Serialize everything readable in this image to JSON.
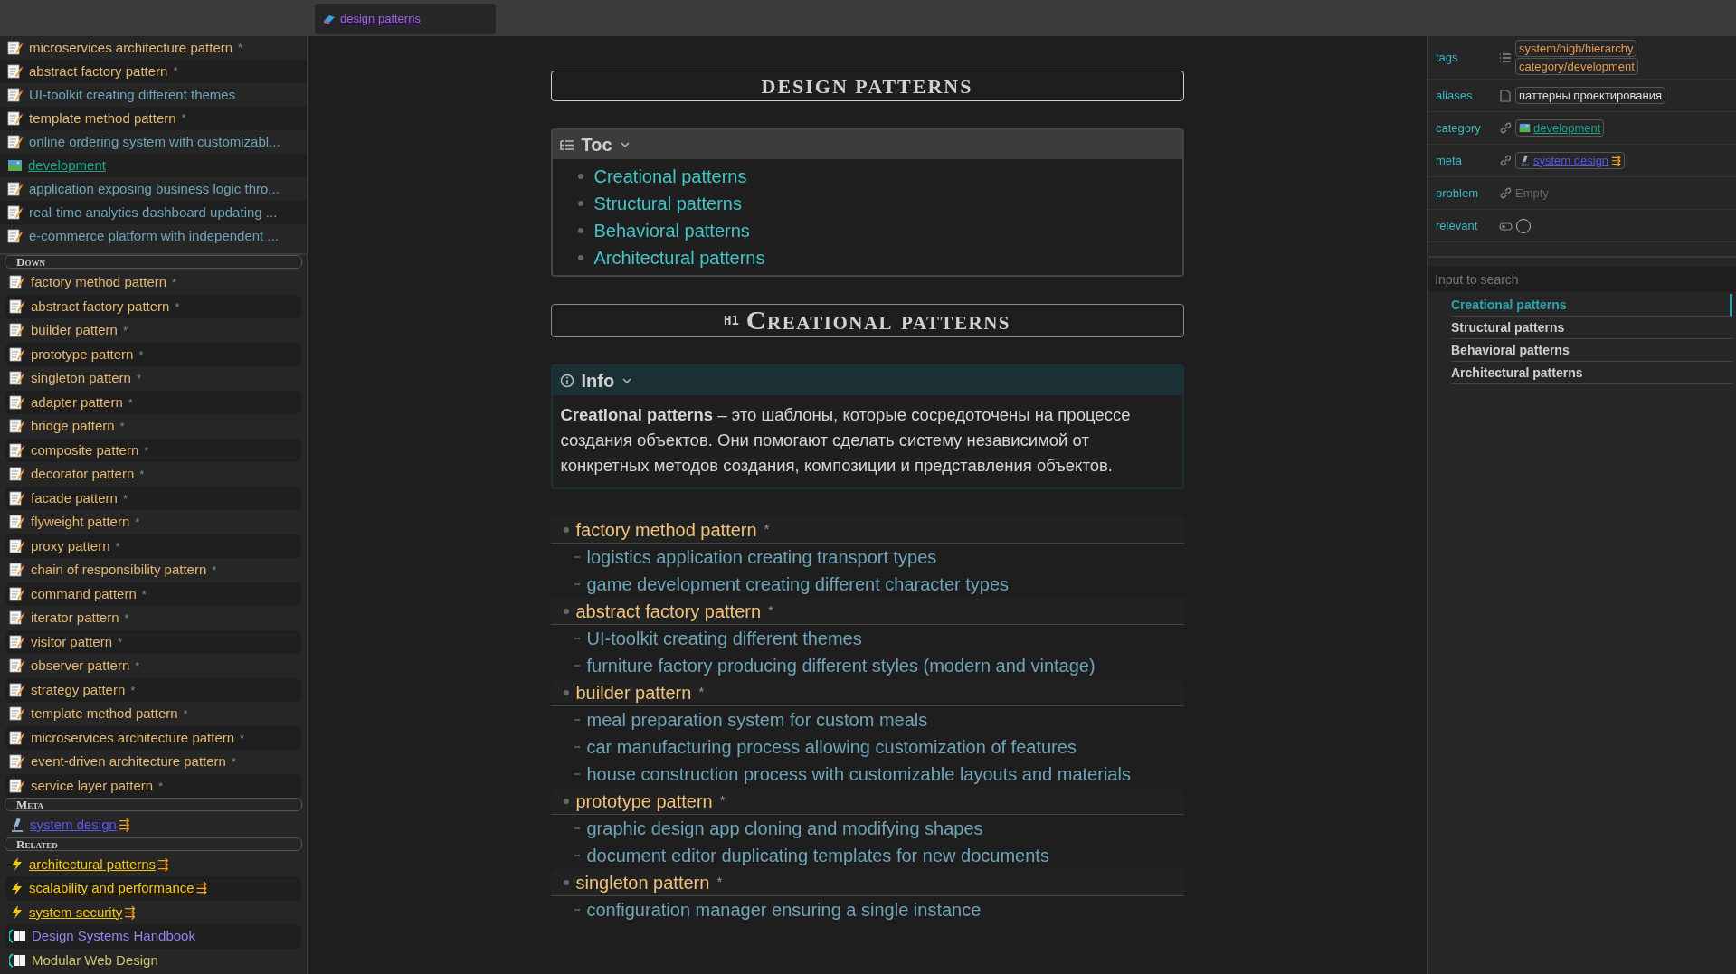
{
  "tab": {
    "label": "design patterns"
  },
  "backlinks": [
    {
      "label": "microservices architecture pattern",
      "suffix": "*",
      "kind": "pattern"
    },
    {
      "label": "abstract factory pattern",
      "suffix": "*",
      "kind": "pattern"
    },
    {
      "label": "UI-toolkit creating different themes",
      "kind": "example"
    },
    {
      "label": "template method pattern",
      "suffix": "*",
      "kind": "pattern"
    },
    {
      "label": "online ordering system with customizabl...",
      "kind": "example"
    },
    {
      "label": "development",
      "kind": "category"
    },
    {
      "label": "application exposing business logic thro...",
      "kind": "example"
    },
    {
      "label": "real-time analytics dashboard updating ...",
      "kind": "example"
    },
    {
      "label": "e-commerce platform with independent ...",
      "kind": "example"
    }
  ],
  "sections": [
    {
      "title": "Down",
      "items": [
        {
          "label": "factory method pattern",
          "suffix": "*",
          "kind": "pattern"
        },
        {
          "label": "abstract factory pattern",
          "suffix": "*",
          "kind": "pattern"
        },
        {
          "label": "builder pattern",
          "suffix": "*",
          "kind": "pattern"
        },
        {
          "label": "prototype pattern",
          "suffix": "*",
          "kind": "pattern"
        },
        {
          "label": "singleton pattern",
          "suffix": "*",
          "kind": "pattern"
        },
        {
          "label": "adapter pattern",
          "suffix": "*",
          "kind": "pattern"
        },
        {
          "label": "bridge pattern",
          "suffix": "*",
          "kind": "pattern"
        },
        {
          "label": "composite pattern",
          "suffix": "*",
          "kind": "pattern"
        },
        {
          "label": "decorator pattern",
          "suffix": "*",
          "kind": "pattern"
        },
        {
          "label": "facade pattern",
          "suffix": "*",
          "kind": "pattern"
        },
        {
          "label": "flyweight pattern",
          "suffix": "*",
          "kind": "pattern"
        },
        {
          "label": "proxy pattern",
          "suffix": "*",
          "kind": "pattern"
        },
        {
          "label": "chain of responsibility pattern",
          "suffix": "*",
          "kind": "pattern"
        },
        {
          "label": "command pattern",
          "suffix": "*",
          "kind": "pattern"
        },
        {
          "label": "iterator pattern",
          "suffix": "*",
          "kind": "pattern"
        },
        {
          "label": "visitor pattern",
          "suffix": "*",
          "kind": "pattern"
        },
        {
          "label": "observer pattern",
          "suffix": "*",
          "kind": "pattern"
        },
        {
          "label": "strategy pattern",
          "suffix": "*",
          "kind": "pattern"
        },
        {
          "label": "template method pattern",
          "suffix": "*",
          "kind": "pattern"
        },
        {
          "label": "microservices architecture pattern",
          "suffix": "*",
          "kind": "pattern"
        },
        {
          "label": "event-driven architecture pattern",
          "suffix": "*",
          "kind": "pattern"
        },
        {
          "label": "service layer pattern",
          "suffix": "*",
          "kind": "pattern"
        }
      ]
    },
    {
      "title": "Meta",
      "items": [
        {
          "label": "system design",
          "mark": "⇶",
          "kind": "meta"
        }
      ]
    },
    {
      "title": "Related",
      "items": [
        {
          "label": "architectural patterns",
          "mark": "⇶",
          "kind": "topic"
        },
        {
          "label": "scalability and performance",
          "mark": "⇶",
          "kind": "topic"
        },
        {
          "label": "system security",
          "mark": "⇶",
          "kind": "topic"
        },
        {
          "label": "Design Systems Handbook",
          "kind": "book",
          "color": "#8f86f0"
        },
        {
          "label": "Modular Web Design",
          "kind": "book",
          "color": "#c9c76a"
        }
      ]
    }
  ],
  "note": {
    "title": "DESIGN PATTERNS",
    "toc": {
      "title": "Toc",
      "items": [
        "Creational patterns",
        "Structural patterns",
        "Behavioral patterns",
        "Architectural patterns"
      ]
    },
    "heading": {
      "level": "H1",
      "text": "Creational patterns"
    },
    "callout": {
      "title": "Info",
      "text": "**Creational patterns** – это шаблоны, которые сосредоточены на процессе создания объектов. Они помогают сделать систему независимой от конкретных методов создания, композиции и представления объектов."
    },
    "list": [
      {
        "label": "factory method pattern",
        "suffix": "*",
        "children": [
          {
            "label": "logistics application creating transport types"
          },
          {
            "label": "game development creating different character types"
          }
        ]
      },
      {
        "label": "abstract factory pattern",
        "suffix": "*",
        "children": [
          {
            "label": "UI-toolkit creating different themes"
          },
          {
            "label": "furniture factory producing different styles (modern and vintage)"
          }
        ]
      },
      {
        "label": "builder pattern",
        "suffix": "*",
        "children": [
          {
            "label": "meal preparation system for custom meals"
          },
          {
            "label": "car manufacturing process allowing customization of features"
          },
          {
            "label": "house construction process with customizable layouts and materials"
          }
        ]
      },
      {
        "label": "prototype pattern",
        "suffix": "*",
        "children": [
          {
            "label": "graphic design app cloning and modifying shapes"
          },
          {
            "label": "document editor duplicating templates for new documents"
          }
        ]
      },
      {
        "label": "singleton pattern",
        "suffix": "*",
        "children": [
          {
            "label": "configuration manager ensuring a single instance"
          }
        ]
      }
    ]
  },
  "properties": [
    {
      "name": "tags",
      "kind": "tags",
      "values": [
        "system/high/hierarchy",
        "category/development"
      ]
    },
    {
      "name": "aliases",
      "kind": "text",
      "values": [
        "паттерны проектирования"
      ]
    },
    {
      "name": "category",
      "kind": "link",
      "link": {
        "label": "development",
        "kind": "category"
      }
    },
    {
      "name": "meta",
      "kind": "link",
      "link": {
        "label": "system design",
        "mark": "⇶",
        "kind": "meta"
      }
    },
    {
      "name": "problem",
      "kind": "empty",
      "placeholder": "Empty"
    },
    {
      "name": "relevant",
      "kind": "checkbox",
      "checked": false
    }
  ],
  "outline": {
    "placeholder": "Input to search",
    "items": [
      {
        "label": "Creational patterns",
        "selected": true
      },
      {
        "label": "Structural patterns",
        "selected": false
      },
      {
        "label": "Behavioral patterns",
        "selected": false
      },
      {
        "label": "Architectural patterns",
        "selected": false
      }
    ]
  }
}
